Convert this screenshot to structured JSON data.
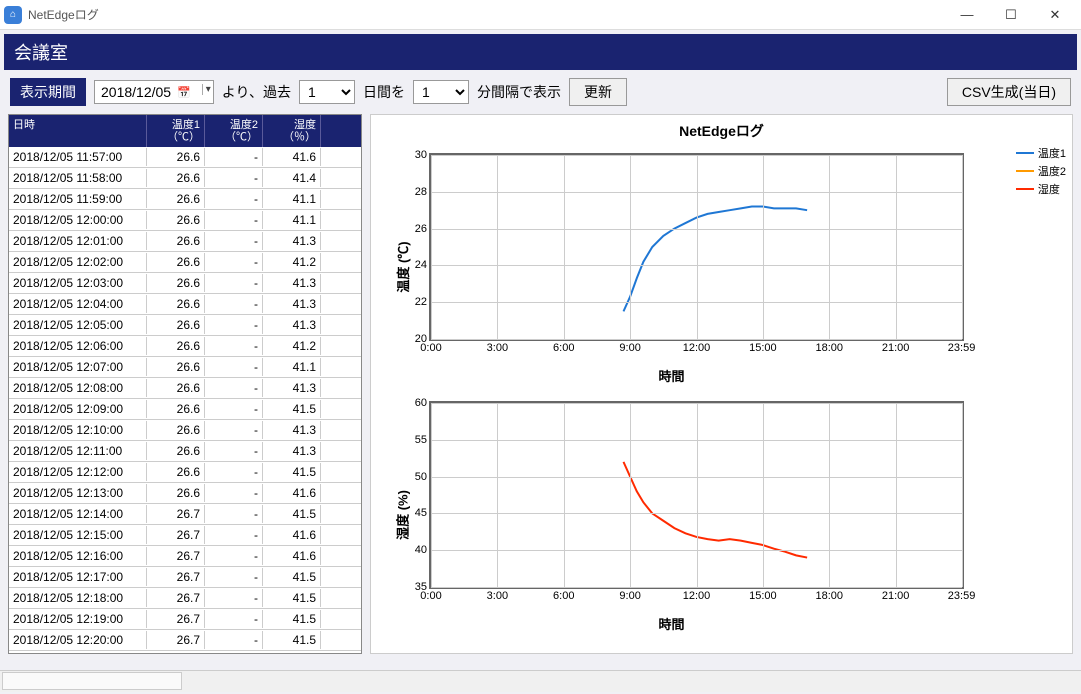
{
  "window": {
    "title": "NetEdgeログ",
    "min": "—",
    "max": "☐",
    "close": "✕"
  },
  "header": {
    "title": "会議室"
  },
  "toolbar": {
    "period_label": "表示期間",
    "date_value": "2018/12/05",
    "text_yori": "より、過去",
    "days_value": "1",
    "text_nichikan": "日間を",
    "interval_value": "1",
    "text_funkan": "分間隔で表示",
    "update_label": "更新",
    "csv_label": "CSV生成(当日)"
  },
  "table": {
    "headers": {
      "date": "日時",
      "t1": "温度1\n（℃）",
      "t2": "温度2\n（℃）",
      "h": "湿度\n（％）"
    },
    "rows": [
      {
        "date": "2018/12/05 11:57:00",
        "t1": "26.6",
        "t2": "-",
        "h": "41.6"
      },
      {
        "date": "2018/12/05 11:58:00",
        "t1": "26.6",
        "t2": "-",
        "h": "41.4"
      },
      {
        "date": "2018/12/05 11:59:00",
        "t1": "26.6",
        "t2": "-",
        "h": "41.1"
      },
      {
        "date": "2018/12/05 12:00:00",
        "t1": "26.6",
        "t2": "-",
        "h": "41.1"
      },
      {
        "date": "2018/12/05 12:01:00",
        "t1": "26.6",
        "t2": "-",
        "h": "41.3"
      },
      {
        "date": "2018/12/05 12:02:00",
        "t1": "26.6",
        "t2": "-",
        "h": "41.2"
      },
      {
        "date": "2018/12/05 12:03:00",
        "t1": "26.6",
        "t2": "-",
        "h": "41.3"
      },
      {
        "date": "2018/12/05 12:04:00",
        "t1": "26.6",
        "t2": "-",
        "h": "41.3"
      },
      {
        "date": "2018/12/05 12:05:00",
        "t1": "26.6",
        "t2": "-",
        "h": "41.3"
      },
      {
        "date": "2018/12/05 12:06:00",
        "t1": "26.6",
        "t2": "-",
        "h": "41.2"
      },
      {
        "date": "2018/12/05 12:07:00",
        "t1": "26.6",
        "t2": "-",
        "h": "41.1"
      },
      {
        "date": "2018/12/05 12:08:00",
        "t1": "26.6",
        "t2": "-",
        "h": "41.3"
      },
      {
        "date": "2018/12/05 12:09:00",
        "t1": "26.6",
        "t2": "-",
        "h": "41.5"
      },
      {
        "date": "2018/12/05 12:10:00",
        "t1": "26.6",
        "t2": "-",
        "h": "41.3"
      },
      {
        "date": "2018/12/05 12:11:00",
        "t1": "26.6",
        "t2": "-",
        "h": "41.3"
      },
      {
        "date": "2018/12/05 12:12:00",
        "t1": "26.6",
        "t2": "-",
        "h": "41.5"
      },
      {
        "date": "2018/12/05 12:13:00",
        "t1": "26.6",
        "t2": "-",
        "h": "41.6"
      },
      {
        "date": "2018/12/05 12:14:00",
        "t1": "26.7",
        "t2": "-",
        "h": "41.5"
      },
      {
        "date": "2018/12/05 12:15:00",
        "t1": "26.7",
        "t2": "-",
        "h": "41.6"
      },
      {
        "date": "2018/12/05 12:16:00",
        "t1": "26.7",
        "t2": "-",
        "h": "41.6"
      },
      {
        "date": "2018/12/05 12:17:00",
        "t1": "26.7",
        "t2": "-",
        "h": "41.5"
      },
      {
        "date": "2018/12/05 12:18:00",
        "t1": "26.7",
        "t2": "-",
        "h": "41.5"
      },
      {
        "date": "2018/12/05 12:19:00",
        "t1": "26.7",
        "t2": "-",
        "h": "41.5"
      },
      {
        "date": "2018/12/05 12:20:00",
        "t1": "26.7",
        "t2": "-",
        "h": "41.5"
      }
    ]
  },
  "legend": {
    "s1": "温度1",
    "c1": "#1f77d4",
    "s2": "温度2",
    "c2": "#ff9a00",
    "s3": "湿度",
    "c3": "#ff2a00"
  },
  "chart_data": [
    {
      "type": "line",
      "title": "NetEdgeログ",
      "xlabel": "時間",
      "ylabel": "温度 (℃)",
      "xticks": [
        "0:00",
        "3:00",
        "6:00",
        "9:00",
        "12:00",
        "15:00",
        "18:00",
        "21:00",
        "23:59"
      ],
      "ylim": [
        20,
        30
      ],
      "yticks": [
        20,
        22,
        24,
        26,
        28,
        30
      ],
      "series": [
        {
          "name": "温度1",
          "color": "#1f77d4",
          "x": [
            8.7,
            9.0,
            9.3,
            9.6,
            10.0,
            10.5,
            11.0,
            11.5,
            12.0,
            12.5,
            13.0,
            13.5,
            14.0,
            14.5,
            15.0,
            15.5,
            16.0,
            16.5,
            17.0
          ],
          "values": [
            21.5,
            22.3,
            23.3,
            24.2,
            25.0,
            25.6,
            26.0,
            26.3,
            26.6,
            26.8,
            26.9,
            27.0,
            27.1,
            27.2,
            27.2,
            27.1,
            27.1,
            27.1,
            27.0
          ]
        },
        {
          "name": "温度2",
          "color": "#ff9a00",
          "x": [],
          "values": []
        }
      ]
    },
    {
      "type": "line",
      "xlabel": "時間",
      "ylabel": "湿度 (%)",
      "xticks": [
        "0:00",
        "3:00",
        "6:00",
        "9:00",
        "12:00",
        "15:00",
        "18:00",
        "21:00",
        "23:59"
      ],
      "ylim": [
        35,
        60
      ],
      "yticks": [
        35,
        40,
        45,
        50,
        55,
        60
      ],
      "series": [
        {
          "name": "湿度",
          "color": "#ff2a00",
          "x": [
            8.7,
            9.0,
            9.3,
            9.6,
            10.0,
            10.5,
            11.0,
            11.5,
            12.0,
            12.5,
            13.0,
            13.5,
            14.0,
            14.5,
            15.0,
            15.5,
            16.0,
            16.5,
            17.0
          ],
          "values": [
            52.0,
            50.0,
            48.0,
            46.5,
            45.0,
            44.0,
            43.0,
            42.3,
            41.8,
            41.5,
            41.3,
            41.5,
            41.3,
            41.0,
            40.7,
            40.2,
            39.8,
            39.3,
            39.0
          ]
        }
      ]
    }
  ]
}
